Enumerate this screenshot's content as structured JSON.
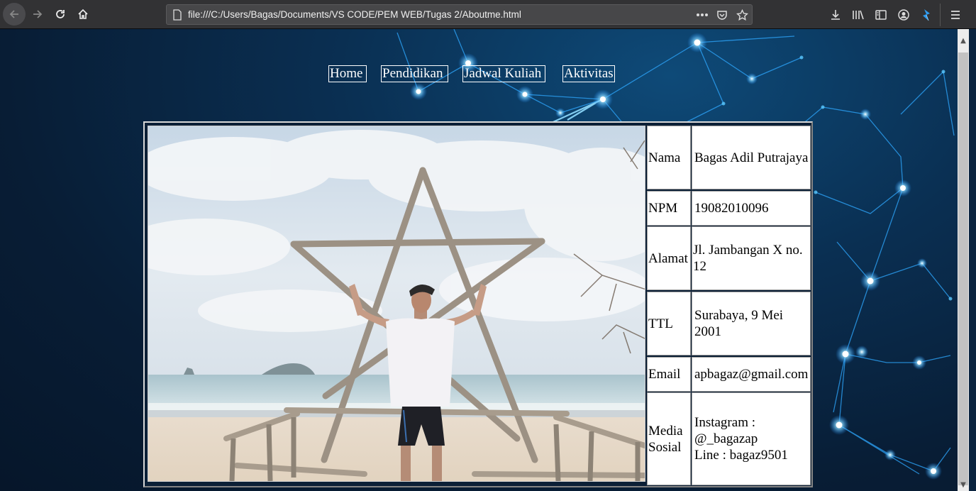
{
  "browser": {
    "url": "file:///C:/Users/Bagas/Documents/VS CODE/PEM WEB/Tugas 2/Aboutme.html",
    "icons": [
      "back-icon",
      "forward-icon",
      "reload-icon",
      "home-icon",
      "page-icon",
      "more-icon",
      "pocket-icon",
      "bookmark-star-icon",
      "download-icon",
      "library-icon",
      "sidebar-icon",
      "account-icon",
      "extension-icon",
      "menu-icon"
    ]
  },
  "nav": {
    "home": "Home",
    "pendidikan": "Pendidikan",
    "jadwal": "Jadwal Kuliah",
    "aktivitas": "Aktivitas"
  },
  "profile": {
    "rows": [
      {
        "label": "Nama",
        "value": "Bagas Adil Putrajaya"
      },
      {
        "label": "NPM",
        "value": "19082010096"
      },
      {
        "label": "Alamat",
        "value": "Jl. Jambangan X no. 12"
      },
      {
        "label": "TTL",
        "value": "Surabaya, 9 Mei 2001"
      },
      {
        "label": "Email",
        "value": "apbagaz@gmail.com"
      },
      {
        "label": "Media Sosial",
        "value_line1": "Instagram :",
        "value_line2": "@_bagazap",
        "value_line3": "Line : bagaz9501"
      }
    ]
  },
  "colors": {
    "background": "#0b2540",
    "accent": "#3ab8ff",
    "chrome": "#323234"
  }
}
